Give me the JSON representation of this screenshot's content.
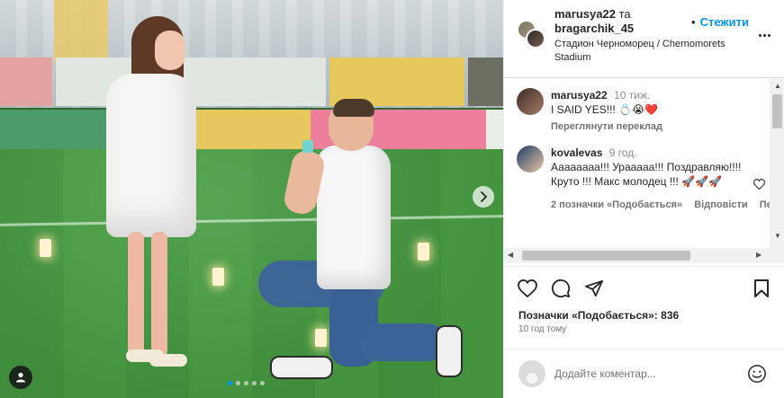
{
  "post": {
    "carousel": {
      "slide_count": 5,
      "active_index": 0
    }
  },
  "header": {
    "user1": "marusya22",
    "conjunction": "та",
    "user2": "bragarchik_45",
    "separator": "•",
    "follow_label": "Стежити",
    "location": "Стадион Черноморец / Chernomorets Stadium"
  },
  "comments": [
    {
      "username": "marusya22",
      "time": "10 тиж.",
      "text": "I SAID YES!!!",
      "emojis": "💍😭❤️",
      "see_translation": "Переглянути переклад"
    },
    {
      "username": "kovalevas",
      "time": "9 год.",
      "text": "Аааааааа!!! Урааааа!!! Поздравляю!!!! Круто !!! Макс молодец !!!",
      "emojis": "🚀🚀🚀",
      "likes": "2 позначки «Подобається»",
      "reply": "Відповісти",
      "translate_cut": "Пер"
    }
  ],
  "actions": {
    "like_icon": "heart-icon",
    "comment_icon": "comment-icon",
    "share_icon": "share-icon",
    "save_icon": "bookmark-icon"
  },
  "likes": {
    "label": "Позначки «Подобається»:",
    "count": "836"
  },
  "posted_time": "10 год тому",
  "add_comment": {
    "placeholder": "Додайте коментар..."
  },
  "colors": {
    "accent": "#0095f6",
    "text": "#262626",
    "secondary": "#737373",
    "like_red": "#ed4956"
  }
}
